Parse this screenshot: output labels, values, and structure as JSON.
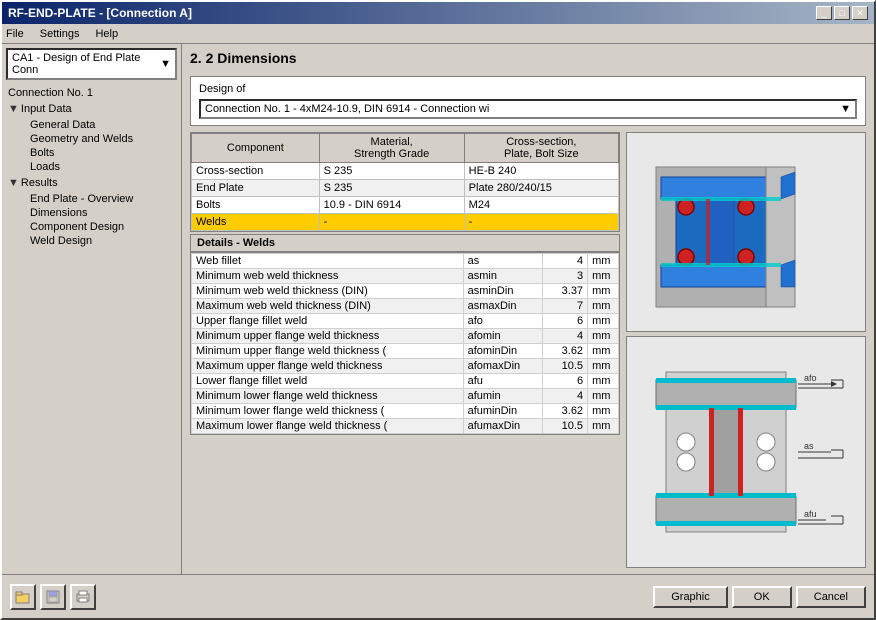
{
  "window": {
    "title": "RF-END-PLATE - [Connection A]"
  },
  "menu": {
    "items": [
      "File",
      "Settings",
      "Help"
    ]
  },
  "sidebar": {
    "dropdown": {
      "value": "CA1 - Design of End Plate Conn",
      "arrow": "▼"
    },
    "connection_label": "Connection No. 1",
    "sections": [
      {
        "label": "Input Data",
        "expanded": true,
        "items": [
          {
            "label": "General Data",
            "active": false
          },
          {
            "label": "Geometry and Welds",
            "active": false
          },
          {
            "label": "Bolts",
            "active": false
          },
          {
            "label": "Loads",
            "active": false
          }
        ]
      },
      {
        "label": "Results",
        "expanded": true,
        "items": [
          {
            "label": "End Plate - Overview",
            "active": false
          },
          {
            "label": "Dimensions",
            "active": true
          },
          {
            "label": "Component Design",
            "active": false
          },
          {
            "label": "Weld Design",
            "active": false
          }
        ]
      }
    ]
  },
  "main": {
    "section_title": "2. 2 Dimensions",
    "design_of": {
      "label": "Design of",
      "value": "Connection No. 1 - 4xM24-10.9, DIN 6914 - Connection wi",
      "arrow": "▼"
    },
    "table": {
      "headers": [
        "Component",
        "Material,\nStrength Grade",
        "Cross-section,\nPlate, Bolt Size"
      ],
      "rows": [
        {
          "component": "Cross-section",
          "material": "S 235",
          "cross_section": "HE-B 240"
        },
        {
          "component": "End Plate",
          "material": "S 235",
          "cross_section": "Plate 280/240/15"
        },
        {
          "component": "Bolts",
          "material": "10.9 - DIN 6914",
          "cross_section": "M24"
        },
        {
          "component": "Welds",
          "material": "-",
          "cross_section": "-",
          "highlighted": true
        }
      ]
    },
    "details": {
      "header": "Details  -  Welds",
      "rows": [
        {
          "label": "Web fillet",
          "sym": "as",
          "value": "4",
          "unit": "mm"
        },
        {
          "label": "Minimum web weld thickness",
          "sym": "asmin",
          "value": "3",
          "unit": "mm"
        },
        {
          "label": "Minimum web weld thickness (DIN)",
          "sym": "asminDin",
          "value": "3.37",
          "unit": "mm"
        },
        {
          "label": "Maximum web weld thickness (DIN)",
          "sym": "asmaxDin",
          "value": "7",
          "unit": "mm"
        },
        {
          "label": "Upper flange fillet weld",
          "sym": "afo",
          "value": "6",
          "unit": "mm"
        },
        {
          "label": "Minimum upper flange weld thickness",
          "sym": "afomin",
          "value": "4",
          "unit": "mm"
        },
        {
          "label": "Minimum upper flange weld thickness (",
          "sym": "afominDin",
          "value": "3.62",
          "unit": "mm"
        },
        {
          "label": "Maximum upper flange weld thickness",
          "sym": "afomaxDin",
          "value": "10.5",
          "unit": "mm"
        },
        {
          "label": "Lower flange fillet weld",
          "sym": "afu",
          "value": "6",
          "unit": "mm"
        },
        {
          "label": "Minimum lower flange weld thickness",
          "sym": "afumin",
          "value": "4",
          "unit": "mm"
        },
        {
          "label": "Minimum lower flange weld thickness (",
          "sym": "afuminDin",
          "value": "3.62",
          "unit": "mm"
        },
        {
          "label": "Maximum lower flange weld thickness (",
          "sym": "afumaxDin",
          "value": "10.5",
          "unit": "mm"
        }
      ]
    }
  },
  "buttons": {
    "graphic": "Graphic",
    "ok": "OK",
    "cancel": "Cancel"
  },
  "icons": {
    "open": "📂",
    "save": "💾",
    "print": "🖨"
  }
}
